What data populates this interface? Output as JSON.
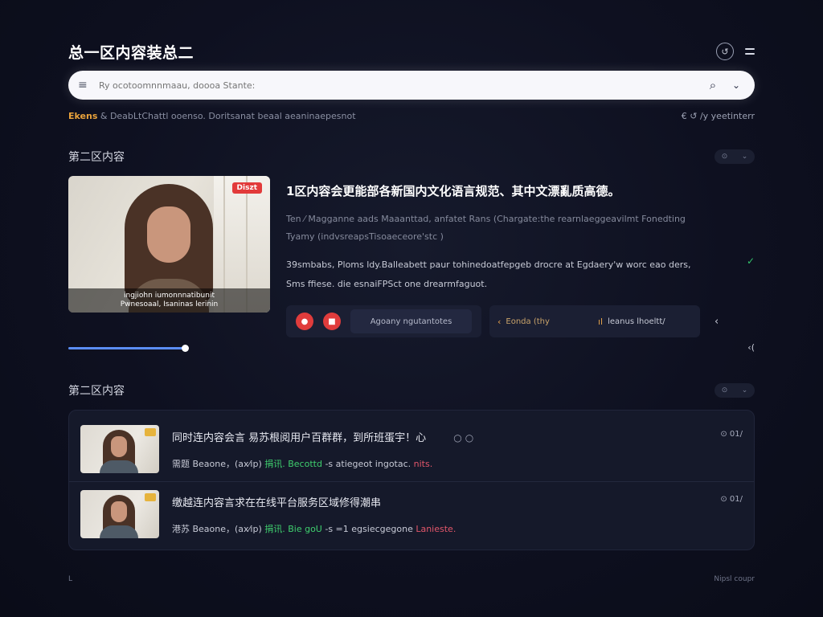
{
  "header": {
    "title": "总一区内容装总二",
    "circle_icon": "circle-arrow-icon",
    "menu_icon": "menu-icon"
  },
  "search": {
    "placeholder": "Ry ocotoomnnmaau, doooa Stante:",
    "lead_icon": "filter-lines-icon",
    "search_icon": "search-icon",
    "dropdown_icon": "chevron-down-icon"
  },
  "status": {
    "tag": "Ekens",
    "text": "& DeabLtChattl ooenso. Doritsanat beaal aeaninaepesnot",
    "right": "€ ↺ /y yeetinterr"
  },
  "section1": {
    "title": "第二区内容"
  },
  "featured": {
    "live_label": "Diszt",
    "subtitle_line1": "ingjiohn iumonnnatibunit",
    "subtitle_line2": "Pwnesoaal, Isaninas lerinin",
    "headline": "1区内容会更能部各新国内文化语言规范、其中文漂亂质高德。",
    "meta_line1": "Ten ⁄ Magganne aads Maaanttad, anfatet Rans (Chargate:the rearnlaeggeavilmt Fonedting",
    "meta_line2": "Tyamy (indvsreapsTisoaeceore'stc )",
    "desc_line1": "39smbabs, Ploms ldy.Balleabett paur tohinedoatfepgeb drocre at Egdaery'w worc eao ders,",
    "desc_line2": "Sms ffiese. die esnaiFPSct one drearmfaguot.",
    "progress_fraction": 0.17,
    "btn1_icon": "record-icon",
    "btn2_icon": "stop-icon",
    "pill_label": "Agoany ngutantotes",
    "item1_label": "Eonda (thy",
    "item2_label": "leanus lhoeltt/",
    "prev_icon": "chevron-left-icon"
  },
  "section2": {
    "title": "第二区内容"
  },
  "list": {
    "items": [
      {
        "title": "同时连内容会言 易苏根阅用户百群群，到所班蛋宇！心",
        "sub_a": "需题 Beaone，(ax⁄ip)",
        "sub_g": "捐讯. Becottd",
        "sub_b": "-s",
        "sub_c": "atiegeot ingotac.",
        "sub_r": "nits.",
        "meta": "⊙ 01/"
      },
      {
        "title": "缴越连内容言求在在线平台服务区域修得潮串",
        "sub_a": "港苏 Beaone，(ax⁄ip)",
        "sub_g": "捐讯. Bie goU",
        "sub_b": "-s =1",
        "sub_c": "egsiecgegone",
        "sub_r": "Lanieste.",
        "meta": "⊙ 01/"
      }
    ]
  },
  "footer": {
    "left": "ᒪ",
    "right": "Nipsl coupr"
  }
}
